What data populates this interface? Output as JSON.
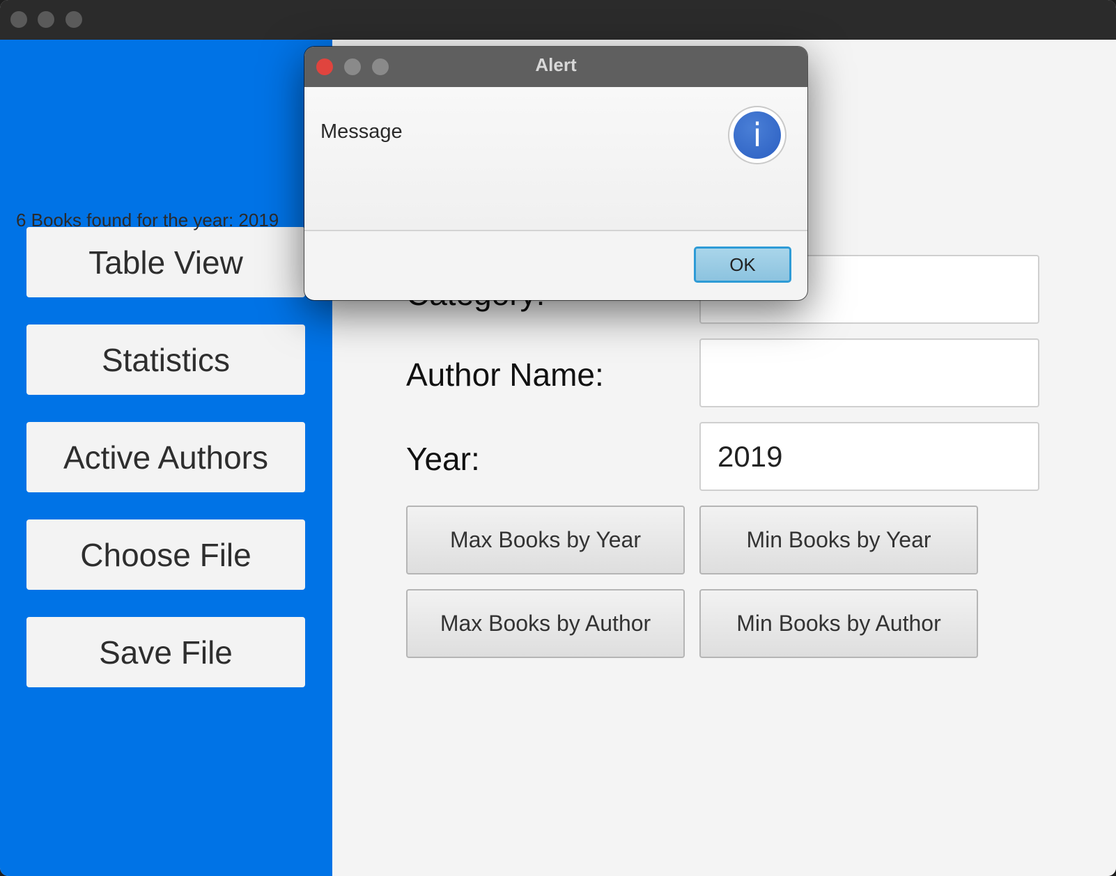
{
  "sidebar": {
    "items": [
      {
        "label": "Table View"
      },
      {
        "label": "Statistics"
      },
      {
        "label": "Active Authors"
      },
      {
        "label": "Choose File"
      },
      {
        "label": "Save File"
      }
    ]
  },
  "form": {
    "category_label": "Category:",
    "category_value": "",
    "author_label": "Author Name:",
    "author_value": "",
    "year_label": "Year:",
    "year_value": "2019"
  },
  "actions": {
    "max_by_year": "Max Books by Year",
    "min_by_year": "Min Books by Year",
    "max_by_author": "Max Books by Author",
    "min_by_author": "Min Books by Author"
  },
  "alert": {
    "title": "Alert",
    "header": "Message",
    "icon": "info-icon",
    "icon_glyph": "i",
    "content": "6 Books found for the year: 2019",
    "ok_label": "OK"
  },
  "colors": {
    "sidebar": "#0073e6",
    "titlebar": "#2b2b2b",
    "close_dot": "#e0443e",
    "inactive_dot": "#8a8a8a",
    "ok_border": "#2e9bd6"
  }
}
